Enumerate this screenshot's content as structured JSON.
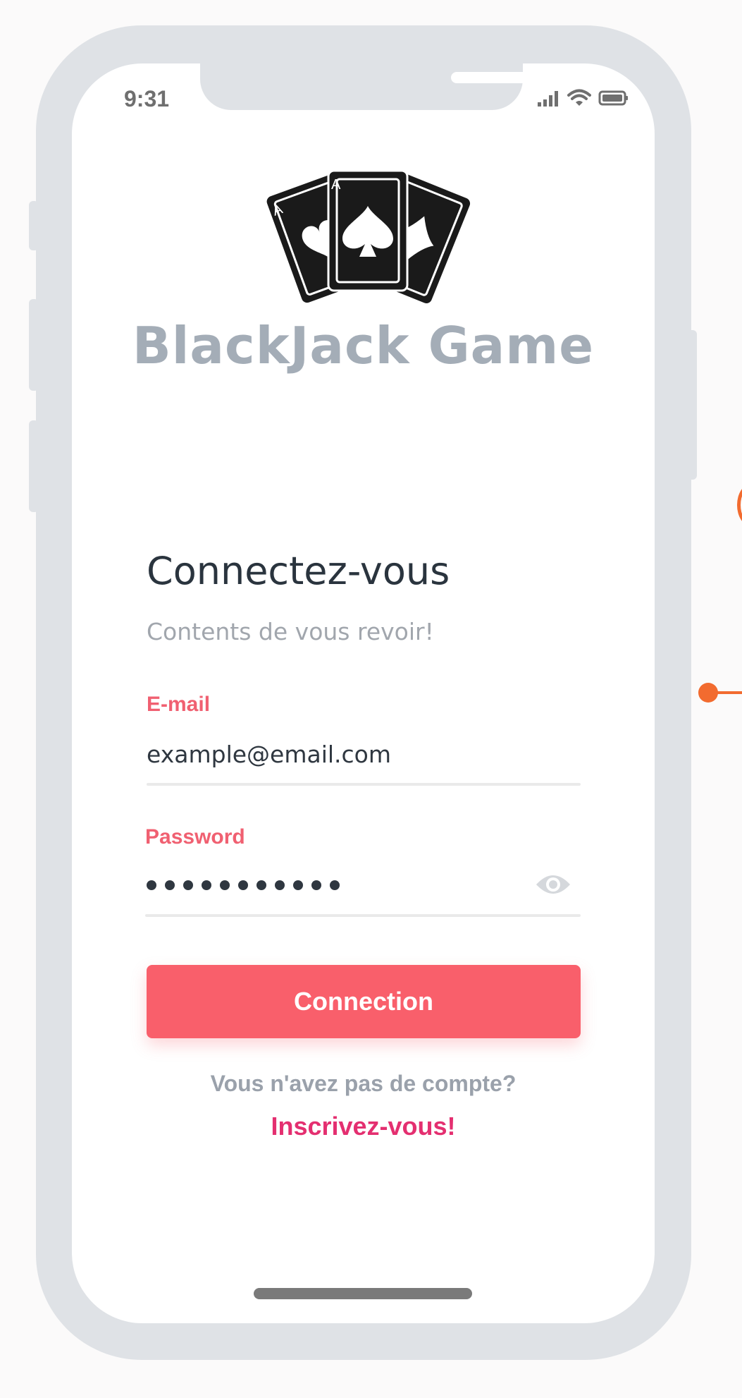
{
  "status_bar": {
    "time": "9:31",
    "icons": [
      "signal-icon",
      "wifi-icon",
      "battery-icon"
    ]
  },
  "logo": {
    "icon": "playing-cards-aces-icon"
  },
  "app_title": "BlackJack Game",
  "login": {
    "heading": "Connectez-vous",
    "subheading": "Contents de vous revoir!",
    "email_label": "E-mail",
    "email_value": "example@email.com",
    "password_label": "Password",
    "password_mask_count": 11,
    "password_toggle_icon": "eye-icon",
    "submit_label": "Connection",
    "no_account_text": "Vous n'avez pas de compte?",
    "signup_link": "Inscrivez-vous!"
  },
  "colors": {
    "accent": "#f95f6b",
    "label": "#f06071",
    "link": "#e42f70",
    "title": "#a4adb7",
    "frame": "#dfe2e6",
    "annotation": "#f26b2f"
  }
}
